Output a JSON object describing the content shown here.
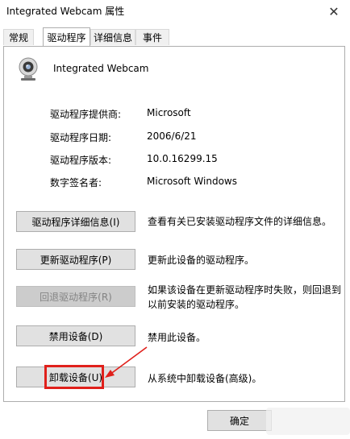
{
  "window": {
    "title": "Integrated Webcam 属性",
    "close_glyph": "✕"
  },
  "tabs": [
    {
      "label": "常规",
      "active": false
    },
    {
      "label": "驱动程序",
      "active": true
    },
    {
      "label": "详细信息",
      "active": false
    },
    {
      "label": "事件",
      "active": false
    }
  ],
  "device": {
    "name": "Integrated Webcam",
    "icon": "webcam-icon"
  },
  "info": [
    {
      "label": "驱动程序提供商:",
      "value": "Microsoft"
    },
    {
      "label": "驱动程序日期:",
      "value": "2006/6/21"
    },
    {
      "label": "驱动程序版本:",
      "value": "10.0.16299.15"
    },
    {
      "label": "数字签名者:",
      "value": "Microsoft Windows"
    }
  ],
  "actions": [
    {
      "button": "驱动程序详细信息(I)",
      "description": "查看有关已安装驱动程序文件的详细信息。",
      "enabled": true
    },
    {
      "button": "更新驱动程序(P)",
      "description": "更新此设备的驱动程序。",
      "enabled": true
    },
    {
      "button": "回退驱动程序(R)",
      "description": "如果该设备在更新驱动程序时失败，则回退到以前安装的驱动程序。",
      "enabled": false
    },
    {
      "button": "禁用设备(D)",
      "description": "禁用此设备。",
      "enabled": true
    },
    {
      "button": "卸载设备(U)",
      "description": "从系统中卸载设备(高级)。",
      "enabled": true
    }
  ],
  "footer": {
    "ok_label": "确定"
  },
  "colors": {
    "highlight": "#e0201b",
    "button_bg": "#e1e1e1",
    "disabled_text": "#838383"
  }
}
